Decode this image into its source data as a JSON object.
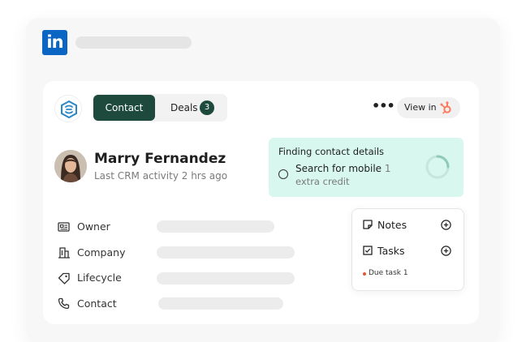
{
  "header": {
    "logo_text": "in"
  },
  "tabs": {
    "contact_label": "Contact",
    "deals_label": "Deals",
    "deals_count": "3"
  },
  "actions": {
    "more_label": "•••",
    "view_in_label": "View in"
  },
  "contact": {
    "name": "Marry Fernandez",
    "activity": "Last CRM activity 2 hrs ago"
  },
  "finding": {
    "title": "Finding contact details",
    "option_label": "Search for mobile",
    "option_credit_count": "1",
    "option_credit_text": "extra credit"
  },
  "fields": [
    {
      "label": "Owner",
      "icon": "id-card-icon"
    },
    {
      "label": "Company",
      "icon": "building-icon"
    },
    {
      "label": "Lifecycle",
      "icon": "tag-icon"
    },
    {
      "label": "Contact",
      "icon": "phone-icon"
    }
  ],
  "popup": {
    "notes_label": "Notes",
    "tasks_label": "Tasks",
    "due_task_label": "Due task 1"
  },
  "colors": {
    "linkedin_blue": "#0a66c2",
    "primary_green": "#1d4a3c",
    "finding_bg": "#d8f7ef",
    "hubspot_orange": "#ff7a59",
    "due_dot": "#e0572f"
  }
}
